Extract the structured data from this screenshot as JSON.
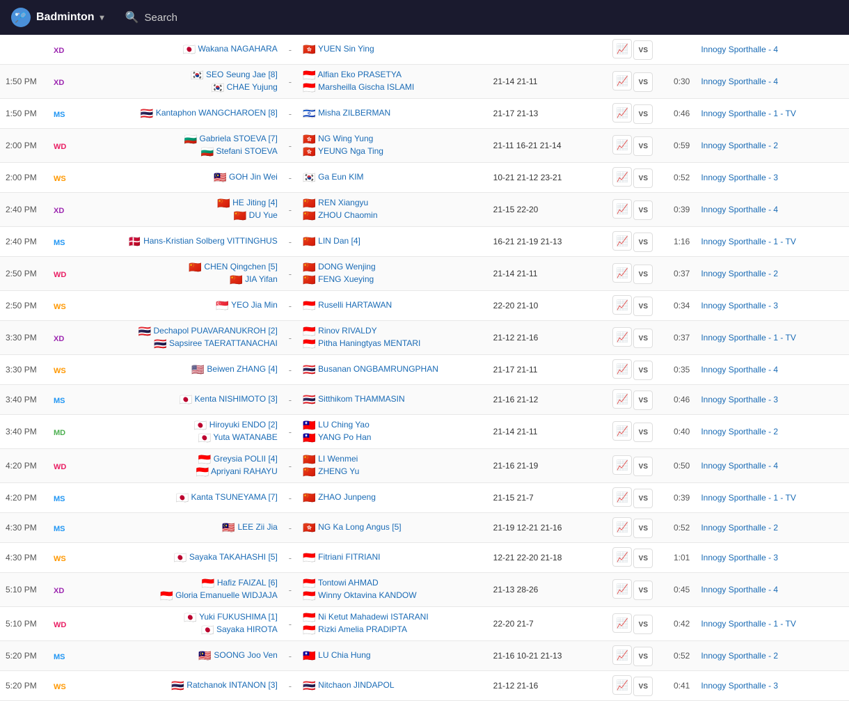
{
  "header": {
    "logo_text": "Badminton",
    "search_placeholder": "Search",
    "chevron": "▾"
  },
  "matches": [
    {
      "id": 0,
      "time": "",
      "type": "XD",
      "type_class": "type-xd",
      "player1": "Wakana NAGAHARA",
      "flag1": "🇯🇵",
      "player2": null,
      "flag2": null,
      "opponent1": "YUEN Sin Ying",
      "oflag1": "🇭🇰",
      "opponent2": null,
      "oflag2": null,
      "score": "",
      "duration": "",
      "venue": "Innogy Sporthalle - 4",
      "double": false
    },
    {
      "id": 1,
      "time": "1:50 PM",
      "type": "XD",
      "type_class": "type-xd",
      "player1": "SEO Seung Jae [8]",
      "flag1": "🇰🇷",
      "player2": "CHAE Yujung",
      "flag2": "🇰🇷",
      "opponent1": "Alfian Eko PRASETYA",
      "oflag1": "🇮🇩",
      "opponent2": "Marsheilla Gischa ISLAMI",
      "oflag2": "🇮🇩",
      "score": "21-14 21-11",
      "duration": "0:30",
      "venue": "Innogy Sporthalle - 4",
      "double": true
    },
    {
      "id": 2,
      "time": "1:50 PM",
      "type": "MS",
      "type_class": "type-ms",
      "player1": "Kantaphon WANGCHAROEN [8]",
      "flag1": "🇹🇭",
      "player2": null,
      "flag2": null,
      "opponent1": "Misha ZILBERMAN",
      "oflag1": "🇮🇱",
      "opponent2": null,
      "oflag2": null,
      "score": "21-17 21-13",
      "duration": "0:46",
      "venue": "Innogy Sporthalle - 1 - TV",
      "double": false
    },
    {
      "id": 3,
      "time": "2:00 PM",
      "type": "WD",
      "type_class": "type-wd",
      "player1": "Gabriela STOEVA [7]",
      "flag1": "🇧🇬",
      "player2": "Stefani STOEVA",
      "flag2": "🇧🇬",
      "opponent1": "NG Wing Yung",
      "oflag1": "🇭🇰",
      "opponent2": "YEUNG Nga Ting",
      "oflag2": "🇭🇰",
      "score": "21-11 16-21 21-14",
      "duration": "0:59",
      "venue": "Innogy Sporthalle - 2",
      "double": true
    },
    {
      "id": 4,
      "time": "2:00 PM",
      "type": "WS",
      "type_class": "type-ws",
      "player1": "GOH Jin Wei",
      "flag1": "🇲🇾",
      "player2": null,
      "flag2": null,
      "opponent1": "Ga Eun KIM",
      "oflag1": "🇰🇷",
      "opponent2": null,
      "oflag2": null,
      "score": "10-21 21-12 23-21",
      "duration": "0:52",
      "venue": "Innogy Sporthalle - 3",
      "double": false
    },
    {
      "id": 5,
      "time": "2:40 PM",
      "type": "XD",
      "type_class": "type-xd",
      "player1": "HE Jiting [4]",
      "flag1": "🇨🇳",
      "player2": "DU Yue",
      "flag2": "🇨🇳",
      "opponent1": "REN Xiangyu",
      "oflag1": "🇨🇳",
      "opponent2": "ZHOU Chaomin",
      "oflag2": "🇨🇳",
      "score": "21-15 22-20",
      "duration": "0:39",
      "venue": "Innogy Sporthalle - 4",
      "double": true
    },
    {
      "id": 6,
      "time": "2:40 PM",
      "type": "MS",
      "type_class": "type-ms",
      "player1": "Hans-Kristian Solberg VITTINGHUS",
      "flag1": "🇩🇰",
      "player2": null,
      "flag2": null,
      "opponent1": "LIN Dan [4]",
      "oflag1": "🇨🇳",
      "opponent2": null,
      "oflag2": null,
      "score": "16-21 21-19 21-13",
      "duration": "1:16",
      "venue": "Innogy Sporthalle - 1 - TV",
      "double": false
    },
    {
      "id": 7,
      "time": "2:50 PM",
      "type": "WD",
      "type_class": "type-wd",
      "player1": "CHEN Qingchen [5]",
      "flag1": "🇨🇳",
      "player2": "JIA Yifan",
      "flag2": "🇨🇳",
      "opponent1": "DONG Wenjing",
      "oflag1": "🇨🇳",
      "opponent2": "FENG Xueying",
      "oflag2": "🇨🇳",
      "score": "21-14 21-11",
      "duration": "0:37",
      "venue": "Innogy Sporthalle - 2",
      "double": true
    },
    {
      "id": 8,
      "time": "2:50 PM",
      "type": "WS",
      "type_class": "type-ws",
      "player1": "YEO Jia Min",
      "flag1": "🇸🇬",
      "player2": null,
      "flag2": null,
      "opponent1": "Ruselli HARTAWAN",
      "oflag1": "🇮🇩",
      "opponent2": null,
      "oflag2": null,
      "score": "22-20 21-10",
      "duration": "0:34",
      "venue": "Innogy Sporthalle - 3",
      "double": false
    },
    {
      "id": 9,
      "time": "3:30 PM",
      "type": "XD",
      "type_class": "type-xd",
      "player1": "Dechapol PUAVARANUKROH [2]",
      "flag1": "🇹🇭",
      "player2": "Sapsiree TAERATTANACHAI",
      "flag2": "🇹🇭",
      "opponent1": "Rinov RIVALDY",
      "oflag1": "🇮🇩",
      "opponent2": "Pitha Haningtyas MENTARI",
      "oflag2": "🇮🇩",
      "score": "21-12 21-16",
      "duration": "0:37",
      "venue": "Innogy Sporthalle - 1 - TV",
      "double": true
    },
    {
      "id": 10,
      "time": "3:30 PM",
      "type": "WS",
      "type_class": "type-ws",
      "player1": "Beiwen ZHANG [4]",
      "flag1": "🇺🇸",
      "player2": null,
      "flag2": null,
      "opponent1": "Busanan ONGBAMRUNGPHAN",
      "oflag1": "🇹🇭",
      "opponent2": null,
      "oflag2": null,
      "score": "21-17 21-11",
      "duration": "0:35",
      "venue": "Innogy Sporthalle - 4",
      "double": false
    },
    {
      "id": 11,
      "time": "3:40 PM",
      "type": "MS",
      "type_class": "type-ms",
      "player1": "Kenta NISHIMOTO [3]",
      "flag1": "🇯🇵",
      "player2": null,
      "flag2": null,
      "opponent1": "Sitthikom THAMMASIN",
      "oflag1": "🇹🇭",
      "opponent2": null,
      "oflag2": null,
      "score": "21-16 21-12",
      "duration": "0:46",
      "venue": "Innogy Sporthalle - 3",
      "double": false
    },
    {
      "id": 12,
      "time": "3:40 PM",
      "type": "MD",
      "type_class": "type-md",
      "player1": "Hiroyuki ENDO [2]",
      "flag1": "🇯🇵",
      "player2": "Yuta WATANABE",
      "flag2": "🇯🇵",
      "opponent1": "LU Ching Yao",
      "oflag1": "🇹🇼",
      "opponent2": "YANG Po Han",
      "oflag2": "🇹🇼",
      "score": "21-14 21-11",
      "duration": "0:40",
      "venue": "Innogy Sporthalle - 2",
      "double": true
    },
    {
      "id": 13,
      "time": "4:20 PM",
      "type": "WD",
      "type_class": "type-wd",
      "player1": "Greysia POLII [4]",
      "flag1": "🇮🇩",
      "player2": "Apriyani RAHAYU",
      "flag2": "🇮🇩",
      "opponent1": "LI Wenmei",
      "oflag1": "🇨🇳",
      "opponent2": "ZHENG Yu",
      "oflag2": "🇨🇳",
      "score": "21-16 21-19",
      "duration": "0:50",
      "venue": "Innogy Sporthalle - 4",
      "double": true
    },
    {
      "id": 14,
      "time": "4:20 PM",
      "type": "MS",
      "type_class": "type-ms",
      "player1": "Kanta TSUNEYAMA [7]",
      "flag1": "🇯🇵",
      "player2": null,
      "flag2": null,
      "opponent1": "ZHAO Junpeng",
      "oflag1": "🇨🇳",
      "opponent2": null,
      "oflag2": null,
      "score": "21-15 21-7",
      "duration": "0:39",
      "venue": "Innogy Sporthalle - 1 - TV",
      "double": false
    },
    {
      "id": 15,
      "time": "4:30 PM",
      "type": "MS",
      "type_class": "type-ms",
      "player1": "LEE Zii Jia",
      "flag1": "🇲🇾",
      "player2": null,
      "flag2": null,
      "opponent1": "NG Ka Long Angus [5]",
      "oflag1": "🇭🇰",
      "opponent2": null,
      "oflag2": null,
      "score": "21-19 12-21 21-16",
      "duration": "0:52",
      "venue": "Innogy Sporthalle - 2",
      "double": false
    },
    {
      "id": 16,
      "time": "4:30 PM",
      "type": "WS",
      "type_class": "type-ws",
      "player1": "Sayaka TAKAHASHI [5]",
      "flag1": "🇯🇵",
      "player2": null,
      "flag2": null,
      "opponent1": "Fitriani FITRIANI",
      "oflag1": "🇮🇩",
      "opponent2": null,
      "oflag2": null,
      "score": "12-21 22-20 21-18",
      "duration": "1:01",
      "venue": "Innogy Sporthalle - 3",
      "double": false
    },
    {
      "id": 17,
      "time": "5:10 PM",
      "type": "XD",
      "type_class": "type-xd",
      "player1": "Hafiz FAIZAL [6]",
      "flag1": "🇮🇩",
      "player2": "Gloria Emanuelle WIDJAJA",
      "flag2": "🇮🇩",
      "opponent1": "Tontowi AHMAD",
      "oflag1": "🇮🇩",
      "opponent2": "Winny Oktavina KANDOW",
      "oflag2": "🇮🇩",
      "score": "21-13 28-26",
      "duration": "0:45",
      "venue": "Innogy Sporthalle - 4",
      "double": true
    },
    {
      "id": 18,
      "time": "5:10 PM",
      "type": "WD",
      "type_class": "type-wd",
      "player1": "Yuki FUKUSHIMA [1]",
      "flag1": "🇯🇵",
      "player2": "Sayaka HIROTA",
      "flag2": "🇯🇵",
      "opponent1": "Ni Ketut Mahadewi ISTARANI",
      "oflag1": "🇮🇩",
      "opponent2": "Rizki Amelia PRADIPTA",
      "oflag2": "🇮🇩",
      "score": "22-20 21-7",
      "duration": "0:42",
      "venue": "Innogy Sporthalle - 1 - TV",
      "double": true
    },
    {
      "id": 19,
      "time": "5:20 PM",
      "type": "MS",
      "type_class": "type-ms",
      "player1": "SOONG Joo Ven",
      "flag1": "🇲🇾",
      "player2": null,
      "flag2": null,
      "opponent1": "LU Chia Hung",
      "oflag1": "🇹🇼",
      "opponent2": null,
      "oflag2": null,
      "score": "21-16 10-21 21-13",
      "duration": "0:52",
      "venue": "Innogy Sporthalle - 2",
      "double": false
    },
    {
      "id": 20,
      "time": "5:20 PM",
      "type": "WS",
      "type_class": "type-ws",
      "player1": "Ratchanok INTANON [3]",
      "flag1": "🇹🇭",
      "player2": null,
      "flag2": null,
      "opponent1": "Nitchaon JINDAPOL",
      "oflag1": "🇹🇭",
      "opponent2": null,
      "oflag2": null,
      "score": "21-12 21-16",
      "duration": "0:41",
      "venue": "Innogy Sporthalle - 3",
      "double": false
    }
  ]
}
